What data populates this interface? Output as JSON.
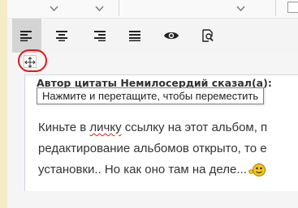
{
  "tooltip": {
    "text": "Нажмите и перетащите, чтобы переместить"
  },
  "quote": {
    "header": "Автор цитаты Немилосердий сказал(а):",
    "lines": [
      "Киньте в ",
      "личку",
      " ссылку на этот альбом, п",
      "редактирование альбомов открыто, то е",
      "установки.. Но как оно там на деле..."
    ],
    "smiley": "smiley-icon"
  },
  "format_toolbar": {
    "buttons": [
      {
        "name": "align-left",
        "icon": "align-left-icon",
        "active": true
      },
      {
        "name": "align-center",
        "icon": "align-center-icon",
        "active": false
      },
      {
        "name": "align-right",
        "icon": "align-right-icon",
        "active": false
      },
      {
        "name": "align-justify",
        "icon": "align-justify-icon",
        "active": false
      },
      {
        "name": "preview",
        "icon": "eye-icon",
        "active": false
      },
      {
        "name": "zoom",
        "icon": "page-magnifier-icon",
        "active": false
      }
    ]
  },
  "move_handle": {
    "icon": "move-arrows-icon"
  },
  "colors": {
    "highlight_circle": "#e01818",
    "active_button": "#d4d4d4",
    "toolbar_bg": "#f4f4f4",
    "left_strip": "#f4ecc4"
  }
}
